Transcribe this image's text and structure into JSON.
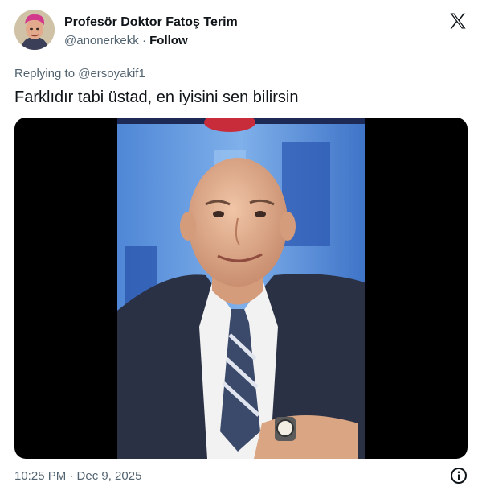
{
  "author": {
    "display_name": "Profesör Doktor Fatoş Terim",
    "handle": "@anonerkekk",
    "separator": "·",
    "follow_label": "Follow",
    "avatar_icon": "profile-avatar"
  },
  "brand": {
    "logo_icon": "x-logo-icon",
    "color": "#0f1419"
  },
  "reply": {
    "prefix": "Replying to",
    "mention": "@ersoyakif1"
  },
  "tweet": {
    "text": "Farklıdır tabi üstad, en iyisini sen bilirsin"
  },
  "media": {
    "type": "photo",
    "subject": "man-in-suit-photo"
  },
  "meta": {
    "timestamp": "10:25 PM · Dec 9, 2025",
    "info_icon": "info-icon"
  },
  "colors": {
    "text": "#0f1419",
    "secondary": "#536471",
    "media_bg": "#000000"
  }
}
